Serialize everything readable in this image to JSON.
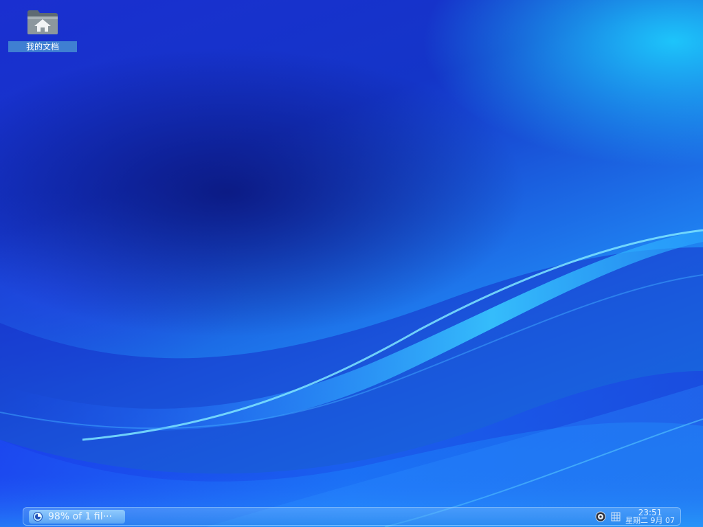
{
  "desktop": {
    "icons": [
      {
        "label": "我的文档",
        "icon": "home-folder-icon"
      }
    ]
  },
  "panel": {
    "task": {
      "label": "98% of 1 fil···",
      "icon": "progress-pie-icon",
      "progress_percent": 98
    },
    "tray": [
      {
        "icon": "disc-icon"
      },
      {
        "icon": "keyboard-icon"
      }
    ],
    "clock": {
      "time": "23:51",
      "date": "星期二  9月 07"
    }
  },
  "colors": {
    "icon_label_bg": "#3f7fd2",
    "wallpaper_deep": "#1428b0",
    "wallpaper_light": "#19c4ff"
  }
}
